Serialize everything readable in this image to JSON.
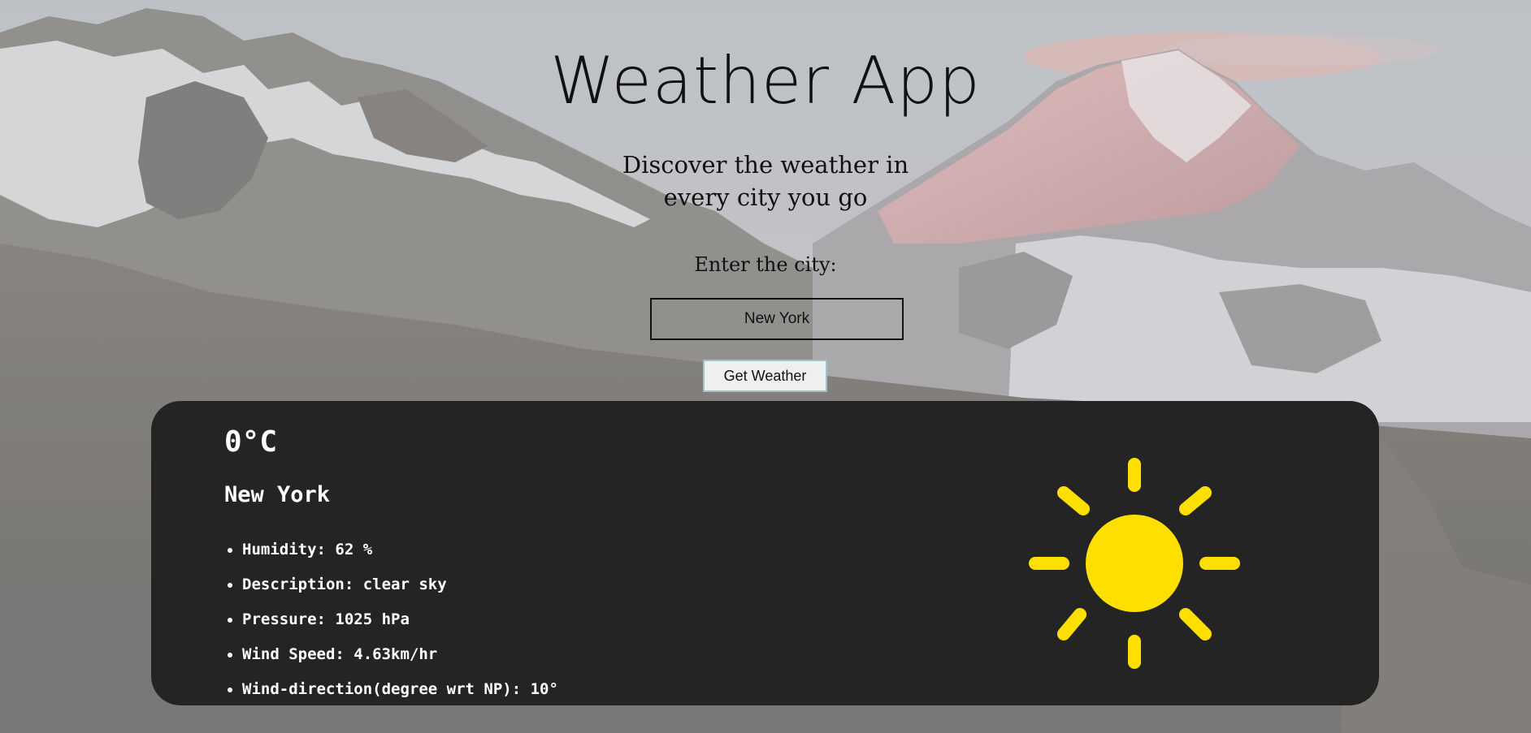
{
  "app": {
    "title": "Weather App",
    "subtitle_line1": "Discover the weather in",
    "subtitle_line2": "every city you go"
  },
  "search": {
    "label": "Enter the city:",
    "value": "New York",
    "button_label": "Get Weather"
  },
  "weather": {
    "temperature": "0°C",
    "city": "New York",
    "details": [
      "Humidity: 62 %",
      "Description: clear sky",
      "Pressure: 1025 hPa",
      "Wind Speed: 4.63km/hr",
      "Wind-direction(degree wrt NP): 10°"
    ],
    "icon": "sun-icon"
  },
  "colors": {
    "card_background": "#242424",
    "sun": "#ffdf00",
    "card_text": "#ffffff"
  }
}
